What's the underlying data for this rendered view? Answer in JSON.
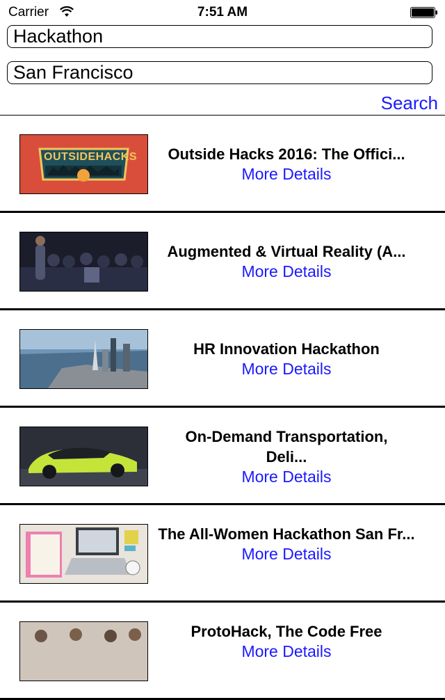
{
  "status_bar": {
    "carrier": "Carrier",
    "time": "7:51 AM"
  },
  "search": {
    "keyword": "Hackathon",
    "location": "San Francisco",
    "button": "Search"
  },
  "events": [
    {
      "title": "Outside Hacks 2016: The Offici...",
      "link": "More Details",
      "logo_text": "OUTSIDEHACKS"
    },
    {
      "title": "Augmented & Virtual Reality (A...",
      "link": "More Details"
    },
    {
      "title": "HR Innovation Hackathon",
      "link": "More Details"
    },
    {
      "title": "On-Demand Transportation, Deli...",
      "link": "More Details"
    },
    {
      "title": "The All-Women Hackathon San Fr...",
      "link": "More Details"
    },
    {
      "title": "ProtoHack, The Code Free",
      "link": "More Details"
    }
  ]
}
